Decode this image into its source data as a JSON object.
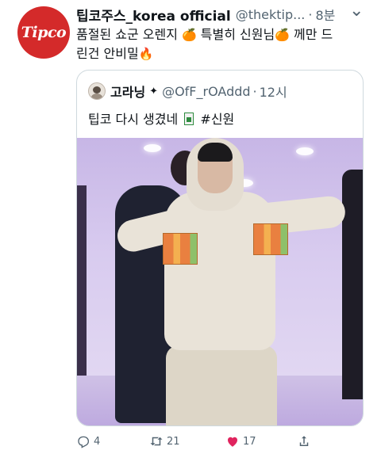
{
  "tweet": {
    "display_name": "팁코주스_korea official",
    "handle": "@thektip...",
    "dot": "·",
    "time": "8분",
    "more": "⌄",
    "avatar_logo": "Tipco",
    "text_line1_a": "품절된 쇼군 오렌지 ",
    "emoji_orange": "🍊",
    "text_line1_b": " 특별히 신원님",
    "text_line1_c": " 께만 드",
    "text_line2": "린건 안비밀",
    "emoji_fire": "🔥"
  },
  "quote": {
    "name": "고라닝",
    "star": "✦",
    "handle": "@OfF_rOAddd",
    "dot": "·",
    "time": "12시",
    "text_a": "팁코 다시 생겼네",
    "text_b": "#신원"
  },
  "actions": {
    "reply_count": "4",
    "retweet_count": "21",
    "like_count": "17"
  },
  "colors": {
    "brand_red": "#d42a2a",
    "like_red": "#e0245e",
    "muted": "#536471"
  }
}
